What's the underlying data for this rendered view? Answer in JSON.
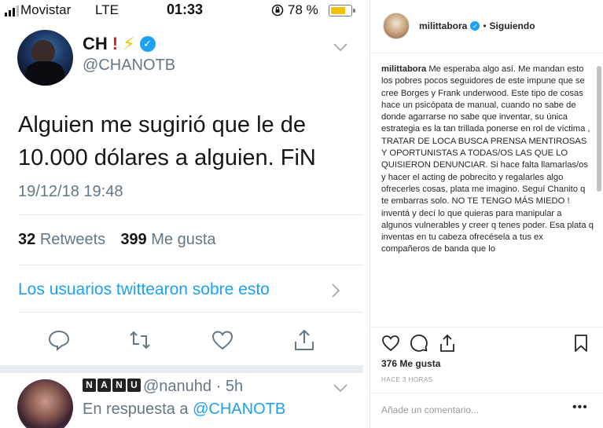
{
  "status_bar": {
    "carrier": "Movistar",
    "network": "LTE",
    "time": "01:33",
    "battery_pct": "78 %",
    "battery_level": 0.78
  },
  "tweet": {
    "author_name": "CH",
    "author_emojis": "❗ ⚡",
    "handle": "@CHANOTB",
    "text": "Alguien me sugirió que le de 10.000 dólares a alguien. FiN",
    "date": "19/12/18 19:48",
    "retweets_count": "32",
    "retweets_label": "Retweets",
    "likes_count": "399",
    "likes_label": "Me gusta",
    "who_tweeted": "Los usuarios twittearon sobre esto"
  },
  "reply": {
    "author_badge": [
      "N",
      "A",
      "N",
      "U"
    ],
    "handle": "@nanuhd · 5h",
    "in_reply_prefix": "En respuesta a",
    "in_reply_to": "@CHANOTB"
  },
  "instagram": {
    "username": "milittabora",
    "follow_status": "Siguiendo",
    "caption_user": "milittabora",
    "caption": "Me esperaba algo así. Me mandan esto los pobres pocos seguidores de este impune que se cree Borges y Frank underwood. Este tipo de cosas hace un psicópata de manual, cuando no sabe de donde agarrarse no sabe que inventar, su única estrategia es la tan trillada ponerse en rol de víctima , TRATAR DE LOCA BUSCA PRENSA MENTIROSAS Y OPORTUNISTAS A TODAS/OS LAS QUE LO QUISIERON DENUNCIAR. Si hace falta llamarlas/os y hacer el acting de pobrecito y regalarles algo ofrecerles cosas, plata me imagino. Seguí Chanito q te embarras solo. NO TE TENGO MÁS MIEDO ! inventá y decí lo que quieras para manipular a algunos vulnerables y creer q tenes poder. Esa plata q inventas en tu cabeza ofrecésela a tus ex compañeros de banda que lo",
    "likes": "376 Me gusta",
    "time_ago": "HACE 3 HORAS",
    "comment_placeholder": "Añade un comentario...",
    "more": "•••"
  }
}
